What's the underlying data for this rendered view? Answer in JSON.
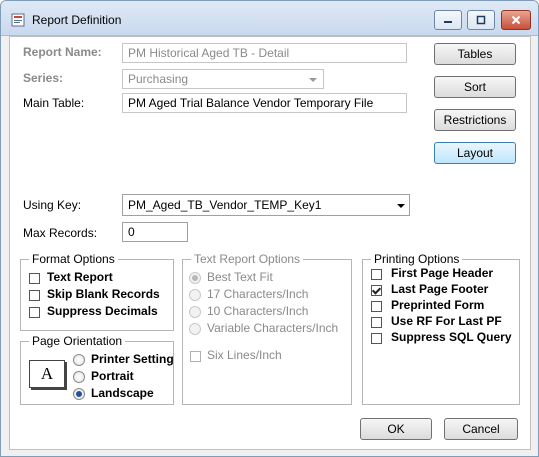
{
  "window": {
    "title": "Report Definition",
    "controls": {
      "minimize": "minimize",
      "maximize": "maximize",
      "close": "close"
    }
  },
  "form": {
    "report_name_label": "Report Name:",
    "report_name_value": "PM Historical Aged TB - Detail",
    "series_label": "Series:",
    "series_value": "Purchasing",
    "main_table_label": "Main Table:",
    "main_table_value": "PM Aged Trial Balance Vendor Temporary File",
    "using_key_label": "Using Key:",
    "using_key_value": "PM_Aged_TB_Vendor_TEMP_Key1",
    "max_records_label": "Max Records:",
    "max_records_value": "0"
  },
  "side_buttons": {
    "tables": "Tables",
    "sort": "Sort",
    "restrictions": "Restrictions",
    "layout": "Layout"
  },
  "format_options": {
    "title": "Format Options",
    "items": [
      {
        "label": "Text Report",
        "checked": false
      },
      {
        "label": "Skip Blank Records",
        "checked": false
      },
      {
        "label": "Suppress Decimals",
        "checked": false
      }
    ]
  },
  "page_orientation": {
    "title": "Page Orientation",
    "page_glyph": "A",
    "items": [
      {
        "label": "Printer Setting",
        "selected": false
      },
      {
        "label": "Portrait",
        "selected": false
      },
      {
        "label": "Landscape",
        "selected": true
      }
    ]
  },
  "text_report_options": {
    "title": "Text Report Options",
    "items": [
      {
        "label": "Best Text Fit",
        "selected": true
      },
      {
        "label": "17 Characters/Inch",
        "selected": false
      },
      {
        "label": "10 Characters/Inch",
        "selected": false
      },
      {
        "label": "Variable Characters/Inch",
        "selected": false
      }
    ],
    "six_lines_label": "Six Lines/Inch"
  },
  "printing_options": {
    "title": "Printing Options",
    "items": [
      {
        "label": "First Page Header",
        "checked": false
      },
      {
        "label": "Last Page Footer",
        "checked": true
      },
      {
        "label": "Preprinted Form",
        "checked": false
      },
      {
        "label": "Use RF For Last PF",
        "checked": false
      },
      {
        "label": "Suppress SQL Query",
        "checked": false
      }
    ]
  },
  "footer": {
    "ok": "OK",
    "cancel": "Cancel"
  }
}
